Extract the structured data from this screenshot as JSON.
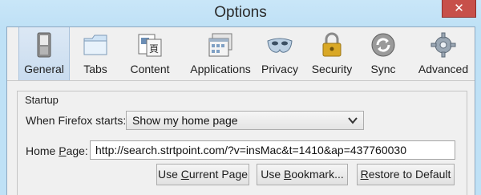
{
  "window": {
    "title": "Options",
    "close_label": "✕"
  },
  "toolbar": {
    "panes": [
      {
        "label": "General"
      },
      {
        "label": "Tabs"
      },
      {
        "label": "Content"
      },
      {
        "label": "Applications"
      },
      {
        "label": "Privacy"
      },
      {
        "label": "Security"
      },
      {
        "label": "Sync"
      },
      {
        "label": "Advanced"
      }
    ],
    "selected": "General"
  },
  "startup": {
    "group_title": "Startup",
    "when_starts_label": "When Firefox starts:",
    "when_starts_value": "Show my home page",
    "home_page_label": {
      "before": "Home ",
      "accel": "P",
      "after": "age:"
    },
    "home_page_value": "http://search.strtpoint.com/?v=insMac&t=1410&ap=437760030"
  },
  "buttons": {
    "use_current": {
      "before": "Use ",
      "accel": "C",
      "after": "urrent Page"
    },
    "use_bookmark": {
      "before": "Use ",
      "accel": "B",
      "after": "ookmark..."
    },
    "restore": {
      "before": "",
      "accel": "R",
      "after": "estore to Default"
    }
  },
  "colors": {
    "titlebar": "#bfe1f6",
    "close_button": "#c7504a",
    "selected_pane": "#c9dcef"
  }
}
